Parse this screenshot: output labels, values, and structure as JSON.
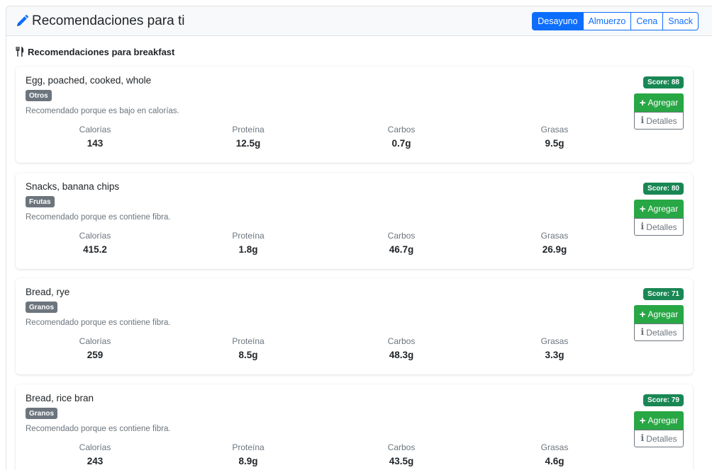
{
  "header": {
    "title": "Recomendaciones para ti",
    "icon": "pencil-icon",
    "accent": "#0d6efd"
  },
  "meal_tabs": [
    {
      "label": "Desayuno",
      "active": true
    },
    {
      "label": "Almuerzo",
      "active": false
    },
    {
      "label": "Cena",
      "active": false
    },
    {
      "label": "Snack",
      "active": false
    }
  ],
  "section": {
    "heading": "Recomendaciones para breakfast",
    "icon": "utensils-icon"
  },
  "labels": {
    "calories": "Calorías",
    "protein": "Proteína",
    "carbs": "Carbos",
    "fat": "Grasas",
    "add": "Agregar",
    "details": "Detalles"
  },
  "colors": {
    "score_badge": "#198754",
    "add_button": "#28a745",
    "category_badge": "#6c757d"
  },
  "recommendations": [
    {
      "name": "Egg, poached, cooked, whole",
      "category": "Otros",
      "reason": "Recomendado porque es bajo en calorías.",
      "score": "Score: 88",
      "calories": "143",
      "protein": "12.5g",
      "carbs": "0.7g",
      "fat": "9.5g"
    },
    {
      "name": "Snacks, banana chips",
      "category": "Frutas",
      "reason": "Recomendado porque es contiene fibra.",
      "score": "Score: 80",
      "calories": "415.2",
      "protein": "1.8g",
      "carbs": "46.7g",
      "fat": "26.9g"
    },
    {
      "name": "Bread, rye",
      "category": "Granos",
      "reason": "Recomendado porque es contiene fibra.",
      "score": "Score: 71",
      "calories": "259",
      "protein": "8.5g",
      "carbs": "48.3g",
      "fat": "3.3g"
    },
    {
      "name": "Bread, rice bran",
      "category": "Granos",
      "reason": "Recomendado porque es contiene fibra.",
      "score": "Score: 79",
      "calories": "243",
      "protein": "8.9g",
      "carbs": "43.5g",
      "fat": "4.6g"
    }
  ]
}
